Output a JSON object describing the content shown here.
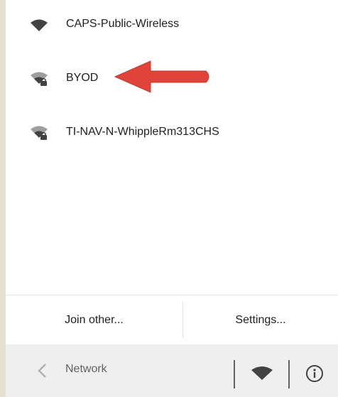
{
  "networks": [
    {
      "name": "CAPS-Public-Wireless",
      "icon": "wifi-full-icon",
      "secured": false
    },
    {
      "name": "BYOD",
      "icon": "wifi-secured-icon",
      "secured": true
    },
    {
      "name": "TI-NAV-N-WhippleRm313CHS",
      "icon": "wifi-secured-icon",
      "secured": true
    }
  ],
  "actions": {
    "join_other": "Join other...",
    "settings": "Settings..."
  },
  "bottom_bar": {
    "back_icon": "chevron-left-icon",
    "title": "Network",
    "wifi_icon": "wifi-icon",
    "info_icon": "info-icon"
  },
  "colors": {
    "arrow": "#e04438",
    "icon": "#424242",
    "background": "#e6e0cf"
  }
}
